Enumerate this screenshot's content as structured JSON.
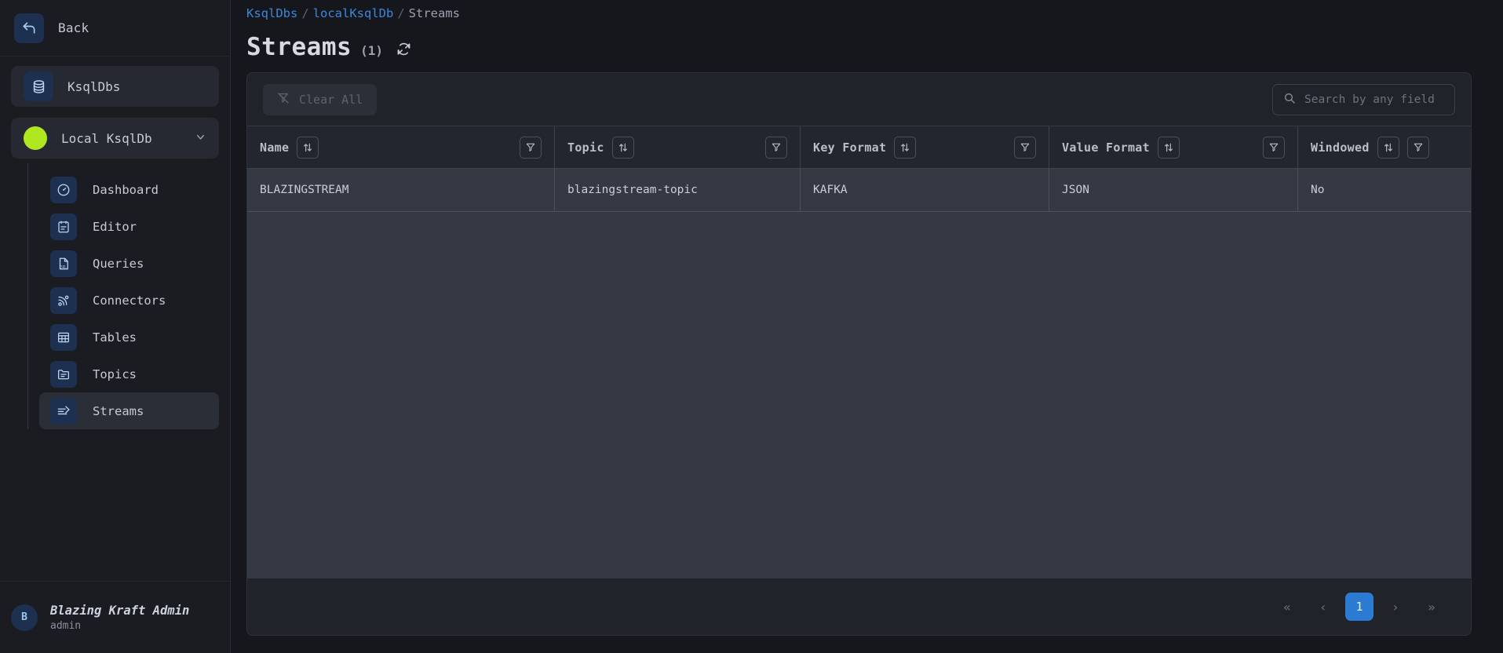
{
  "sidebar": {
    "back": {
      "label": "Back",
      "icon": "back-arrow-icon"
    },
    "root": {
      "label": "KsqlDbs",
      "icon": "database-icon"
    },
    "cluster": {
      "label": "Local KsqlDb",
      "status_color": "#b0e820",
      "chevron": "⌄"
    },
    "items": [
      {
        "label": "Dashboard",
        "icon": "gauge-icon"
      },
      {
        "label": "Editor",
        "icon": "clipboard-icon"
      },
      {
        "label": "Queries",
        "icon": "sql-file-icon"
      },
      {
        "label": "Connectors",
        "icon": "connector-icon"
      },
      {
        "label": "Tables",
        "icon": "table-grid-icon"
      },
      {
        "label": "Topics",
        "icon": "folder-list-icon"
      },
      {
        "label": "Streams",
        "icon": "streams-icon",
        "active": true
      }
    ],
    "user": {
      "initial": "B",
      "name": "Blazing Kraft Admin",
      "role": "admin"
    }
  },
  "breadcrumb": {
    "root": "KsqlDbs",
    "cluster": "localKsqlDb",
    "current": "Streams",
    "separator": "/"
  },
  "page": {
    "title": "Streams",
    "count": "(1)",
    "refresh_icon": "refresh-icon"
  },
  "toolbar": {
    "clear_all_label": "Clear All",
    "clear_all_icon": "filter-off-icon",
    "search_placeholder": "Search by any field",
    "search_value": "",
    "search_icon": "search-icon"
  },
  "table": {
    "columns": [
      {
        "label": "Name",
        "sort_icon": "sort-icon",
        "filter_icon": "filter-icon"
      },
      {
        "label": "Topic",
        "sort_icon": "sort-icon",
        "filter_icon": "filter-icon"
      },
      {
        "label": "Key Format",
        "sort_icon": "sort-icon",
        "filter_icon": "filter-icon"
      },
      {
        "label": "Value Format",
        "sort_icon": "sort-icon",
        "filter_icon": "filter-icon"
      },
      {
        "label": "Windowed",
        "sort_icon": "sort-icon",
        "filter_icon": "filter-icon"
      }
    ],
    "rows": [
      {
        "name": "BLAZINGSTREAM",
        "topic": "blazingstream-topic",
        "key_format": "KAFKA",
        "value_format": "JSON",
        "windowed": "No"
      }
    ]
  },
  "pagination": {
    "first": "«",
    "prev": "‹",
    "current_page": "1",
    "next": "›",
    "last": "»",
    "active_color": "#2a7bd1"
  }
}
